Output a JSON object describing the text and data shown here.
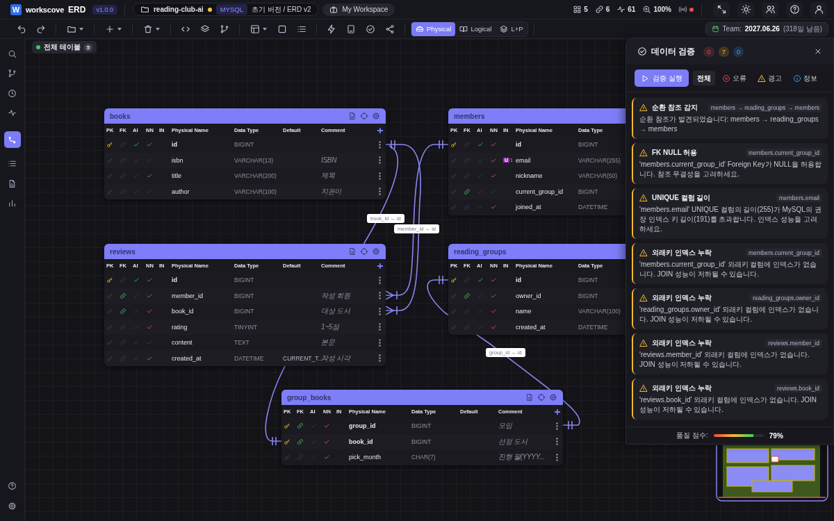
{
  "header": {
    "logo_letter": "W",
    "brand": "workscove",
    "product": "ERD",
    "version": "v1.0.0",
    "project": {
      "name": "reading-club-ai",
      "unsaved": true,
      "db": "MYSQL",
      "branch": "초기 버전 / ERD v2"
    },
    "workspace": "My Workspace",
    "stats": [
      {
        "kind": "tables",
        "value": "5"
      },
      {
        "kind": "relations",
        "value": "6"
      },
      {
        "kind": "activity",
        "value": "61"
      },
      {
        "kind": "zoom",
        "value": "100%"
      }
    ],
    "live": true
  },
  "toolbar": {
    "view_modes": [
      {
        "kind": "physical",
        "label": "Physical",
        "selected": true
      },
      {
        "kind": "logical",
        "label": "Logical",
        "selected": false
      },
      {
        "kind": "both",
        "label": "L+P",
        "selected": false
      }
    ],
    "team": {
      "label": "Team:",
      "date": "2027.06.26",
      "remaining": "(318일 남음)"
    }
  },
  "sidebar": {
    "items": [
      {
        "kind": "search",
        "selected": false
      },
      {
        "kind": "branch",
        "selected": false
      },
      {
        "kind": "history",
        "selected": false
      },
      {
        "kind": "activity",
        "selected": false
      },
      {
        "kind": "diagram",
        "selected": true
      },
      {
        "kind": "list",
        "selected": false
      },
      {
        "kind": "document",
        "selected": false
      },
      {
        "kind": "chart",
        "selected": false
      }
    ],
    "bottom": [
      {
        "kind": "help"
      },
      {
        "kind": "settings"
      }
    ]
  },
  "canvas": {
    "filter_chip": {
      "label": "전체 테이블",
      "count": "5",
      "active": true
    },
    "tables": [
      {
        "name": "books",
        "headers": [
          "PK",
          "FK",
          "AI",
          "NN",
          "IN",
          "Physical Name",
          "Data Type",
          "Default",
          "Comment"
        ],
        "rows": [
          {
            "pk": true,
            "fk": false,
            "ai": true,
            "nn": true,
            "name": "id",
            "type": "BIGINT"
          },
          {
            "pk": false,
            "fk": false,
            "ai": false,
            "nn": false,
            "name": "isbn",
            "type": "VARCHAR(13)",
            "comment": "ISBN"
          },
          {
            "pk": false,
            "fk": false,
            "ai": false,
            "nn": true,
            "name": "title",
            "type": "VARCHAR(200)",
            "comment": "제목"
          },
          {
            "pk": false,
            "fk": false,
            "ai": false,
            "nn": false,
            "name": "author",
            "type": "VARCHAR(100)",
            "comment": "지은이"
          }
        ]
      },
      {
        "name": "members",
        "headers": [
          "PK",
          "FK",
          "AI",
          "NN",
          "IN",
          "Physical Name",
          "Data Type"
        ],
        "rows": [
          {
            "pk": true,
            "fk": false,
            "ai": true,
            "nn": true,
            "name": "id",
            "type": "BIGINT"
          },
          {
            "pk": false,
            "fk": false,
            "ai": false,
            "nn": true,
            "name": "email",
            "type": "VARCHAR(255)",
            "unique": {
              "label": "U",
              "index": "1"
            }
          },
          {
            "pk": false,
            "fk": false,
            "ai": false,
            "nn": true,
            "name": "nickname",
            "type": "VARCHAR(50)"
          },
          {
            "pk": false,
            "fk": true,
            "ai": false,
            "nn": false,
            "name": "current_group_id",
            "type": "BIGINT"
          },
          {
            "pk": false,
            "fk": false,
            "ai": false,
            "nn": true,
            "name": "joined_at",
            "type": "DATETIME"
          }
        ]
      },
      {
        "name": "reviews",
        "headers": [
          "PK",
          "FK",
          "AI",
          "NN",
          "IN",
          "Physical Name",
          "Data Type",
          "Default",
          "Comment"
        ],
        "rows": [
          {
            "pk": true,
            "fk": false,
            "ai": true,
            "nn": true,
            "name": "id",
            "type": "BIGINT"
          },
          {
            "pk": false,
            "fk": true,
            "ai": false,
            "nn": true,
            "name": "member_id",
            "type": "BIGINT",
            "comment": "작성 회원"
          },
          {
            "pk": false,
            "fk": true,
            "ai": false,
            "nn": true,
            "name": "book_id",
            "type": "BIGINT",
            "comment": "대상 도서"
          },
          {
            "pk": false,
            "fk": false,
            "ai": false,
            "nn": true,
            "name": "rating",
            "type": "TINYINT",
            "comment": "1~5점"
          },
          {
            "pk": false,
            "fk": false,
            "ai": false,
            "nn": false,
            "name": "content",
            "type": "TEXT",
            "comment": "본문"
          },
          {
            "pk": false,
            "fk": false,
            "ai": false,
            "nn": true,
            "name": "created_at",
            "type": "DATETIME",
            "default": "CURRENT_T...",
            "comment": "작성 시각"
          }
        ]
      },
      {
        "name": "reading_groups",
        "headers": [
          "PK",
          "FK",
          "AI",
          "NN",
          "IN",
          "Physical Name",
          "Data Type"
        ],
        "rows": [
          {
            "pk": true,
            "fk": false,
            "ai": true,
            "nn": true,
            "name": "id",
            "type": "BIGINT"
          },
          {
            "pk": false,
            "fk": true,
            "ai": false,
            "nn": true,
            "name": "owner_id",
            "type": "BIGINT"
          },
          {
            "pk": false,
            "fk": false,
            "ai": false,
            "nn": true,
            "name": "name",
            "type": "VARCHAR(100)"
          },
          {
            "pk": false,
            "fk": false,
            "ai": false,
            "nn": true,
            "name": "created_at",
            "type": "DATETIME"
          }
        ]
      },
      {
        "name": "group_books",
        "headers": [
          "PK",
          "FK",
          "AI",
          "NN",
          "IN",
          "Physical Name",
          "Data Type",
          "Default",
          "Comment"
        ],
        "rows": [
          {
            "pk": true,
            "fk": true,
            "ai": false,
            "nn": true,
            "name": "group_id",
            "type": "BIGINT",
            "comment": "모임"
          },
          {
            "pk": true,
            "fk": true,
            "ai": false,
            "nn": true,
            "name": "book_id",
            "type": "BIGINT",
            "comment": "선정 도서"
          },
          {
            "pk": false,
            "fk": false,
            "ai": false,
            "nn": true,
            "name": "pick_month",
            "type": "CHAR(7)",
            "comment": "진행 월(YYYY..."
          }
        ]
      }
    ],
    "relation_labels": [
      "book_id → id",
      "member_id → id",
      "group_id → id"
    ]
  },
  "panel": {
    "title": "데이터 검증",
    "counts": [
      {
        "kind": "error",
        "value": "0"
      },
      {
        "kind": "warning",
        "value": "7"
      },
      {
        "kind": "info",
        "value": "0"
      }
    ],
    "run_label": "검증 실행",
    "filters": [
      {
        "kind": "all",
        "label": "전체",
        "selected": true
      },
      {
        "kind": "error",
        "label": "오류",
        "selected": false
      },
      {
        "kind": "warning",
        "label": "경고",
        "selected": false
      },
      {
        "kind": "info",
        "label": "정보",
        "selected": false
      }
    ],
    "issues": [
      {
        "title": "순환 참조 감지",
        "target": "members → reading_groups → members",
        "message": "순환 참조가 발견되었습니다: members → reading_groups → members"
      },
      {
        "title": "FK NULL 허용",
        "target": "members.current_group_id",
        "message": "'members.current_group_id' Foreign Key가 NULL을 허용합니다. 참조 무결성을 고려하세요."
      },
      {
        "title": "UNIQUE 컬럼 길이",
        "target": "members.email",
        "message": "'members.email' UNIQUE 컬럼의 길이(255)가 MySQL의 권장 인덱스 키 길이(191)를 초과합니다. 인덱스 성능을 고려하세요."
      },
      {
        "title": "외래키 인덱스 누락",
        "target": "members.current_group_id",
        "message": "'members.current_group_id' 외래키 컬럼에 인덱스가 없습니다. JOIN 성능이 저하될 수 있습니다."
      },
      {
        "title": "외래키 인덱스 누락",
        "target": "reading_groups.owner_id",
        "message": "'reading_groups.owner_id' 외래키 컬럼에 인덱스가 없습니다. JOIN 성능이 저하될 수 있습니다."
      },
      {
        "title": "외래키 인덱스 누락",
        "target": "reviews.member_id",
        "message": "'reviews.member_id' 외래키 컬럼에 인덱스가 없습니다. JOIN 성능이 저하될 수 있습니다."
      },
      {
        "title": "외래키 인덱스 누락",
        "target": "reviews.book_id",
        "message": "'reviews.book_id' 외래키 컬럼에 인덱스가 없습니다. JOIN 성능이 저하될 수 있습니다."
      }
    ],
    "score_label": "품질 점수:",
    "score": {
      "level": 0.79
    },
    "score_text": "79%"
  }
}
